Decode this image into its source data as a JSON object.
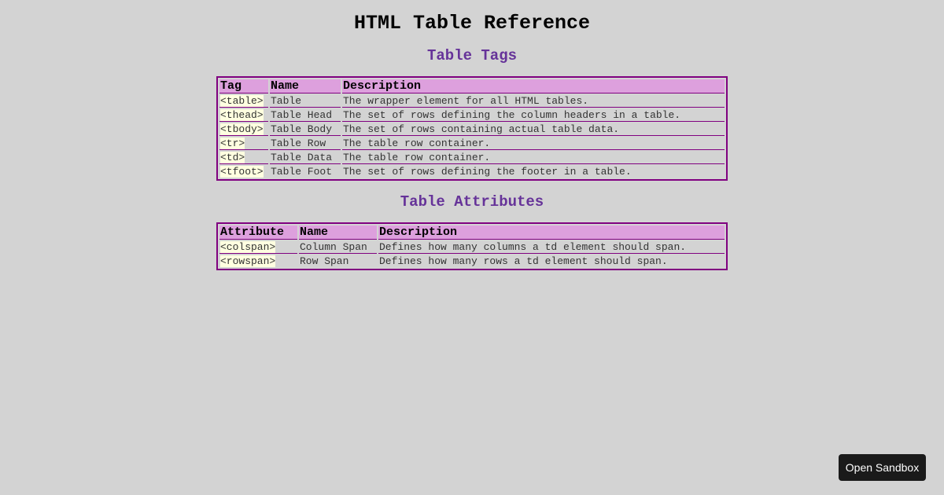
{
  "page": {
    "title": "HTML Table Reference"
  },
  "tags_section": {
    "title": "Table Tags",
    "headers": [
      "Tag",
      "Name",
      "Description"
    ],
    "rows": [
      {
        "tag": "<table>",
        "name": "Table",
        "description": "The wrapper element for all HTML tables."
      },
      {
        "tag": "<thead>",
        "name": "Table Head",
        "description": "The set of rows defining the column headers in a table."
      },
      {
        "tag": "<tbody>",
        "name": "Table Body",
        "description": "The set of rows containing actual table data."
      },
      {
        "tag": "<tr>",
        "name": "Table Row",
        "description": "The table row container."
      },
      {
        "tag": "<td>",
        "name": "Table Data",
        "description": "The table row container."
      },
      {
        "tag": "<tfoot>",
        "name": "Table Foot",
        "description": "The set of rows defining the footer in a table."
      }
    ]
  },
  "attributes_section": {
    "title": "Table Attributes",
    "headers": [
      "Attribute",
      "Name",
      "Description"
    ],
    "rows": [
      {
        "attribute": "<colspan>",
        "name": "Column Span",
        "description": "Defines how many columns a td element should span."
      },
      {
        "attribute": "<rowspan>",
        "name": "Row Span",
        "description": "Defines how many rows a td element should span."
      }
    ]
  },
  "sandbox_button": {
    "label": "Open Sandbox"
  },
  "colors": {
    "background": "#d3d3d3",
    "section_title": "#663399",
    "table_border": "#800080",
    "header_bg": "#dda0dd",
    "code_bg": "#ffffe0",
    "button_bg": "#1a1a1a"
  }
}
